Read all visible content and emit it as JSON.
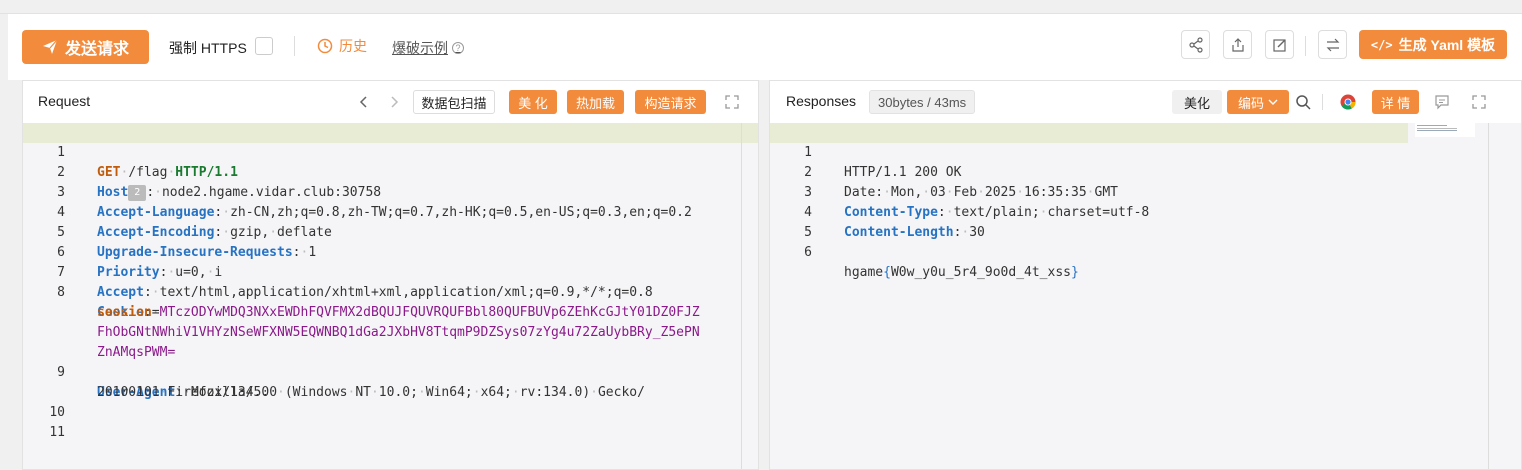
{
  "toolbar": {
    "send_label": "发送请求",
    "https_label": "强制 HTTPS",
    "history_label": "历史",
    "burst_label": "爆破示例",
    "yaml_label": "生成 Yaml 模板"
  },
  "request": {
    "title": "Request",
    "scan_label": "数据包扫描",
    "beautify_label": "美 化",
    "hotload_label": "热加载",
    "construct_label": "构造请求",
    "lines": [
      {
        "n": "1",
        "method": "GET",
        "path": "/flag",
        "version": "HTTP/1.1"
      },
      {
        "n": "2",
        "key": "Host",
        "badge": "2",
        "value": "node2.hgame.vidar.club:30758"
      },
      {
        "n": "3",
        "key": "Accept-Language",
        "value": "zh-CN,zh;q=0.8,zh-TW;q=0.7,zh-HK;q=0.5,en-US;q=0.3,en;q=0.2"
      },
      {
        "n": "4",
        "key": "Accept-Encoding",
        "value": "gzip, deflate"
      },
      {
        "n": "5",
        "key": "Upgrade-Insecure-Requests",
        "value": "1"
      },
      {
        "n": "6",
        "key": "Priority",
        "value": "u=0, i"
      },
      {
        "n": "7",
        "key": "Accept",
        "value": "text/html,application/xhtml+xml,application/xml;q=0.9,*/*;q=0.8"
      },
      {
        "n": "8",
        "key": "Cookie",
        "value": ""
      },
      {
        "cookie_name": "session",
        "cookie_value_1": "MTczODYwMDQ3NXxEWDhFQVFMX2dBQUJFQUVRQUFBbl80QUFBUVp6ZEhKcGJtY01DZ0FJZ",
        "cookie_value_2": "FhObGNtNWhiV1VHYzNSeWFXNW5EQWNBQ1dGa2JXbHV8TtqmP9DZSys07zYg4u72ZaUybBRy_Z5ePN",
        "cookie_value_3": "ZnAMqsPWM="
      },
      {
        "n": "9",
        "key": "User-Agent",
        "value": "Mozilla/5.0 (Windows NT 10.0; Win64; x64; rv:134.0) Gecko/",
        "value_cont": "20100101 Firefox/134.0"
      },
      {
        "n": "10"
      },
      {
        "n": "11"
      }
    ]
  },
  "response": {
    "title": "Responses",
    "size_badge": "30bytes / 43ms",
    "beautify_label": "美化",
    "encode_label": "编码",
    "detail_label": "详 情",
    "lines": [
      {
        "n": "1",
        "status": "HTTP/1.1 200 OK"
      },
      {
        "n": "2",
        "plain": "Date: Mon, 03 Feb 2025 16:35:35 GMT"
      },
      {
        "n": "3",
        "key": "Content-Type",
        "value": "text/plain; charset=utf-8"
      },
      {
        "n": "4",
        "key": "Content-Length",
        "value": "30"
      },
      {
        "n": "5"
      },
      {
        "n": "6",
        "flag_prefix": "hgame",
        "flag_body": "W0w_y0u_5r4_9o0d_4t_xss"
      }
    ]
  },
  "colors": {
    "accent": "#f28b3c",
    "header_key": "#2672c3",
    "cookie_value": "#8a1a8a"
  }
}
